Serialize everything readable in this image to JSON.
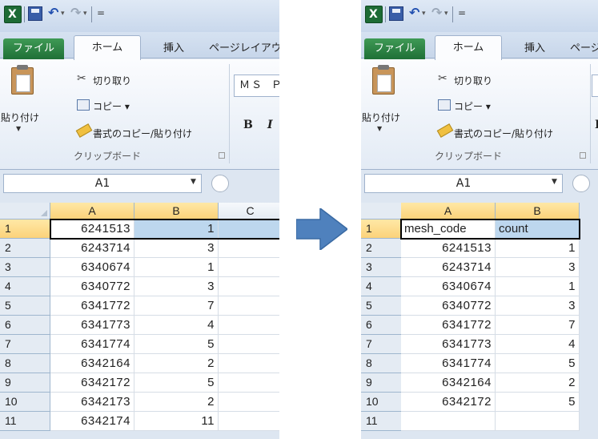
{
  "ribbon": {
    "tabs": {
      "file": "ファイル",
      "home": "ホーム",
      "insert": "挿入",
      "page_layout": "ページレイアウト"
    },
    "clipboard": {
      "paste": "貼り付け",
      "cut": "切り取り",
      "copy": "コピー ▾",
      "format_painter": "書式のコピー/貼り付け",
      "group_label": "クリップボード"
    },
    "font_name": "ＭＳ Ｐゴシック",
    "bold": "B",
    "italic": "I"
  },
  "formula_bar": {
    "name_box": "A1"
  },
  "icons": [
    "excel-icon",
    "save-icon",
    "undo-icon",
    "redo-icon",
    "paste-icon",
    "cut-icon",
    "copy-icon",
    "format-painter-icon",
    "right-arrow-icon"
  ],
  "colors": {
    "arrow": "#4f81bd",
    "file_tab": "#2b7a3f",
    "selected_header": "#fbd27a",
    "highlight_cell": "#bdd7ee"
  },
  "before": {
    "columns": [
      "A",
      "B",
      "C"
    ],
    "rows": [
      {
        "n": "1",
        "a": "6241513",
        "b": "1"
      },
      {
        "n": "2",
        "a": "6243714",
        "b": "3"
      },
      {
        "n": "3",
        "a": "6340674",
        "b": "1"
      },
      {
        "n": "4",
        "a": "6340772",
        "b": "3"
      },
      {
        "n": "5",
        "a": "6341772",
        "b": "7"
      },
      {
        "n": "6",
        "a": "6341773",
        "b": "4"
      },
      {
        "n": "7",
        "a": "6341774",
        "b": "5"
      },
      {
        "n": "8",
        "a": "6342164",
        "b": "2"
      },
      {
        "n": "9",
        "a": "6342172",
        "b": "5"
      },
      {
        "n": "10",
        "a": "6342173",
        "b": "2"
      },
      {
        "n": "11",
        "a": "6342174",
        "b": "11"
      }
    ]
  },
  "after": {
    "columns": [
      "A",
      "B"
    ],
    "rows": [
      {
        "n": "1",
        "a": "mesh_code",
        "b": "count"
      },
      {
        "n": "2",
        "a": "6241513",
        "b": "1"
      },
      {
        "n": "3",
        "a": "6243714",
        "b": "3"
      },
      {
        "n": "4",
        "a": "6340674",
        "b": "1"
      },
      {
        "n": "5",
        "a": "6340772",
        "b": "3"
      },
      {
        "n": "6",
        "a": "6341772",
        "b": "7"
      },
      {
        "n": "7",
        "a": "6341773",
        "b": "4"
      },
      {
        "n": "8",
        "a": "6341774",
        "b": "5"
      },
      {
        "n": "9",
        "a": "6342164",
        "b": "2"
      },
      {
        "n": "10",
        "a": "6342172",
        "b": "5"
      },
      {
        "n": "11",
        "a": "",
        "b": ""
      }
    ]
  }
}
